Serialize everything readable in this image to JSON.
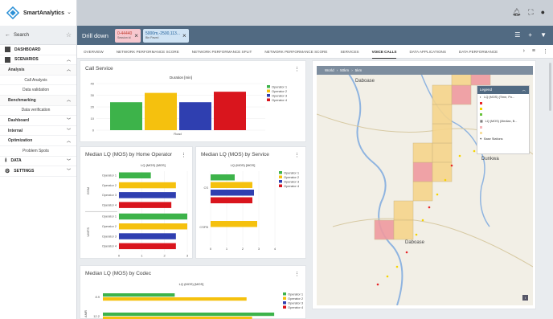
{
  "brand": {
    "name": "SmartAnalytics"
  },
  "sidebar": {
    "search_label": "Search",
    "items": [
      {
        "label": "DASHBOARD"
      },
      {
        "label": "SCENARIOS"
      },
      {
        "label": "Analysis"
      },
      {
        "label": "Call Analysis"
      },
      {
        "label": "Data validation"
      },
      {
        "label": "Benchmarking"
      },
      {
        "label": "Data verification"
      },
      {
        "label": "Dashboard"
      },
      {
        "label": "Internal"
      },
      {
        "label": "Optimization"
      },
      {
        "label": "Problem Spots"
      },
      {
        "label": "DATA"
      },
      {
        "label": "SETTINGS"
      }
    ]
  },
  "header": {
    "title": "Drill down",
    "chips": [
      {
        "line1": "0-44440",
        "line2": "Session id"
      },
      {
        "line1": "5000m,-2500,113...",
        "line2": "Bin Paved"
      }
    ]
  },
  "tabs": [
    {
      "label": "OVERVIEW"
    },
    {
      "label": "NETWORK PERFORMANCE SCORE"
    },
    {
      "label": "NETWORK PERFORMANCE SPLIT"
    },
    {
      "label": "NETWORK PERFORMANCE SCORE"
    },
    {
      "label": "SERVICES"
    },
    {
      "label": "VOICE CALLS"
    },
    {
      "label": "DATA APPLICATIONS"
    },
    {
      "label": "DATA PERFORMANCE"
    }
  ],
  "colors": {
    "operator1": "#3db34a",
    "operator2": "#f5c10e",
    "operator3": "#2f3fb0",
    "operator4": "#d9151d"
  },
  "cards": {
    "call_service": {
      "title": "Call Service"
    },
    "home_operator": {
      "title": "Median LQ (MOS) by Home Operator"
    },
    "by_service": {
      "title": "Median LQ (MOS) by Service"
    },
    "by_codec": {
      "title": "Median LQ (MOS) by Codec"
    }
  },
  "map": {
    "breadcrumb": [
      "World",
      "50km",
      "5km"
    ],
    "labels": {
      "daboase_top": "Daboase",
      "daboase_mid": "Daboase",
      "dunkwa": "Dunkwa"
    },
    "legend": {
      "title": "Legend",
      "layer1": "LQ (MOS) (Time, Po...",
      "layer2": "LQ (MOS) (Median, B...",
      "layer3": "Base Stations"
    }
  },
  "chart_data": [
    {
      "type": "bar",
      "title": "Duration [min]",
      "categories": [
        "Road"
      ],
      "series": [
        {
          "name": "Operator 1",
          "values": [
            24
          ]
        },
        {
          "name": "Operator 2",
          "values": [
            32
          ]
        },
        {
          "name": "Operator 3",
          "values": [
            24
          ]
        },
        {
          "name": "Operator 4",
          "values": [
            33
          ]
        }
      ],
      "ylim": [
        0,
        40
      ],
      "yticks": [
        0,
        10,
        20,
        30,
        40
      ],
      "legend": "right"
    },
    {
      "type": "bar",
      "orientation": "horizontal",
      "title": "LQ (MOS) [MOS]",
      "groups": [
        "GSM",
        "UMTS"
      ],
      "categories": [
        "Operator 1",
        "Operator 2",
        "Operator 3",
        "Operator 4",
        "Operator 1",
        "Operator 2",
        "Operator 3",
        "Operator 4"
      ],
      "values": [
        1.4,
        2.5,
        2.5,
        2.3,
        3.0,
        3.0,
        2.5,
        2.5
      ],
      "xlim": [
        0,
        3
      ],
      "xticks": [
        0,
        1,
        2,
        3
      ]
    },
    {
      "type": "bar",
      "orientation": "horizontal",
      "title": "LQ (MOS) [MOS]",
      "categories": [
        "CS",
        "CSFB"
      ],
      "series": [
        {
          "name": "Operator 1",
          "values": [
            1.5,
            0
          ]
        },
        {
          "name": "Operator 2",
          "values": [
            2.6,
            2.9
          ]
        },
        {
          "name": "Operator 3",
          "values": [
            2.7,
            0
          ]
        },
        {
          "name": "Operator 4",
          "values": [
            2.6,
            0
          ]
        }
      ],
      "xlim": [
        0,
        4
      ],
      "xticks": [
        0,
        1,
        2,
        3,
        4
      ],
      "legend": "right"
    },
    {
      "type": "bar",
      "orientation": "horizontal",
      "title": "LQ (MOS) [MOS]",
      "categories": [
        "8.9",
        "12.2"
      ],
      "series": [
        {
          "name": "Operator 1",
          "values": [
            1.3,
            3.1
          ]
        },
        {
          "name": "Operator 2",
          "values": [
            2.6,
            2.7
          ]
        },
        {
          "name": "Operator 3",
          "values": [
            0,
            0
          ]
        },
        {
          "name": "Operator 4",
          "values": [
            0,
            0
          ]
        }
      ],
      "legend": "right"
    }
  ]
}
